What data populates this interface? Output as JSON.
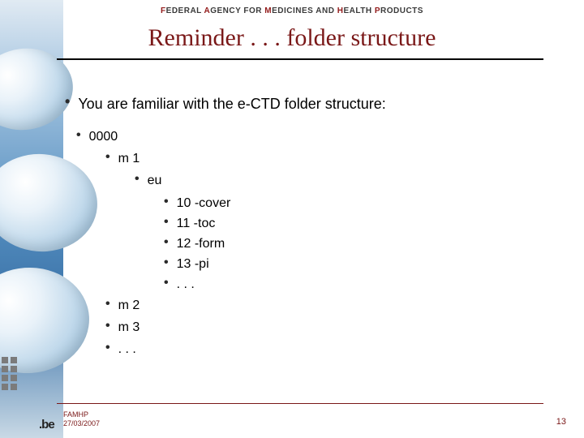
{
  "agency": {
    "text": "FEDERAL AGENCY FOR MEDICINES AND HEALTH PRODUCTS"
  },
  "title": "Reminder . . . folder structure",
  "intro": "You are familiar with the e-CTD folder structure:",
  "tree": {
    "root": "0000",
    "m1": "m 1",
    "eu": "eu",
    "eu_items": [
      "10 -cover",
      "11 -toc",
      "12 -form",
      "13 -pi",
      ". . ."
    ],
    "siblings": [
      "m 2",
      "m 3",
      ". . ."
    ]
  },
  "footer": {
    "org": "FAMHP",
    "date": "27/03/2007",
    "logo": ".be",
    "page": "13"
  }
}
